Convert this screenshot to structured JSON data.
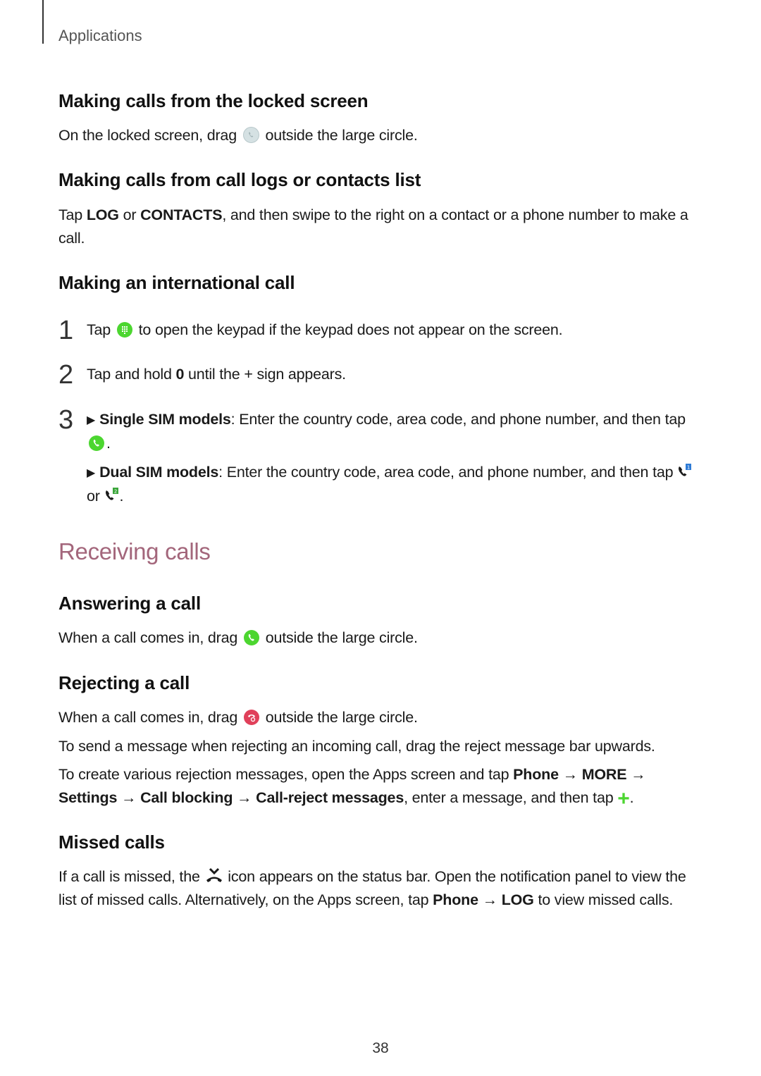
{
  "header": {
    "section": "Applications"
  },
  "locked_screen": {
    "title": "Making calls from the locked screen",
    "text_before": "On the locked screen, drag",
    "icon": "phone-lock-icon",
    "text_after": "outside the large circle."
  },
  "call_logs": {
    "title": "Making calls from call logs or contacts list",
    "t1": "Tap ",
    "b1": "LOG",
    "t2": " or ",
    "b2": "CONTACTS",
    "t3": ", and then swipe to the right on a contact or a phone number to make a call."
  },
  "international": {
    "title": "Making an international call",
    "steps": [
      {
        "num": "1",
        "t1": "Tap",
        "icon": "keypad-icon",
        "t2": "to open the keypad if the keypad does not appear on the screen."
      },
      {
        "num": "2",
        "t1": "Tap and hold ",
        "b1": "0",
        "t2": " until the + sign appears."
      },
      {
        "num": "3",
        "single_label": "Single SIM models",
        "single_text": ": Enter the country code, area code, and phone number, and then tap",
        "single_icon": "call-icon",
        "dual_label": "Dual SIM models",
        "dual_text": ": Enter the country code, area code, and phone number, and then tap",
        "dual_or": "or",
        "dual_icons": [
          "sim1-call-icon",
          "sim2-call-icon"
        ],
        "sim1": "1",
        "sim2": "2"
      }
    ]
  },
  "receiving": {
    "title": "Receiving calls",
    "accent_color": "#a3667b"
  },
  "answering": {
    "title": "Answering a call",
    "text_before": "When a call comes in, drag",
    "icon": "answer-call-icon",
    "text_after": "outside the large circle."
  },
  "rejecting": {
    "title": "Rejecting a call",
    "p1_before": "When a call comes in, drag",
    "p1_icon": "reject-call-icon",
    "p1_after": "outside the large circle.",
    "p2": "To send a message when rejecting an incoming call, drag the reject message bar upwards.",
    "p3_t1": "To create various rejection messages, open the Apps screen and tap ",
    "p3_b1": "Phone",
    "p3_arrow": " → ",
    "p3_b2": "MORE",
    "p3_b3": "Settings",
    "p3_b4": "Call blocking",
    "p3_b5": "Call-reject messages",
    "p3_t2": ", enter a message, and then tap",
    "p3_icon": "plus-icon",
    "p3_end": "."
  },
  "missed": {
    "title": "Missed calls",
    "t1": "If a call is missed, the",
    "icon": "missed-call-icon",
    "t2": "icon appears on the status bar. Open the notification panel to view the list of missed calls. Alternatively, on the Apps screen, tap ",
    "b1": "Phone",
    "arrow": " → ",
    "b2": "LOG",
    "t3": " to view missed calls."
  },
  "footer": {
    "page_number": "38"
  }
}
